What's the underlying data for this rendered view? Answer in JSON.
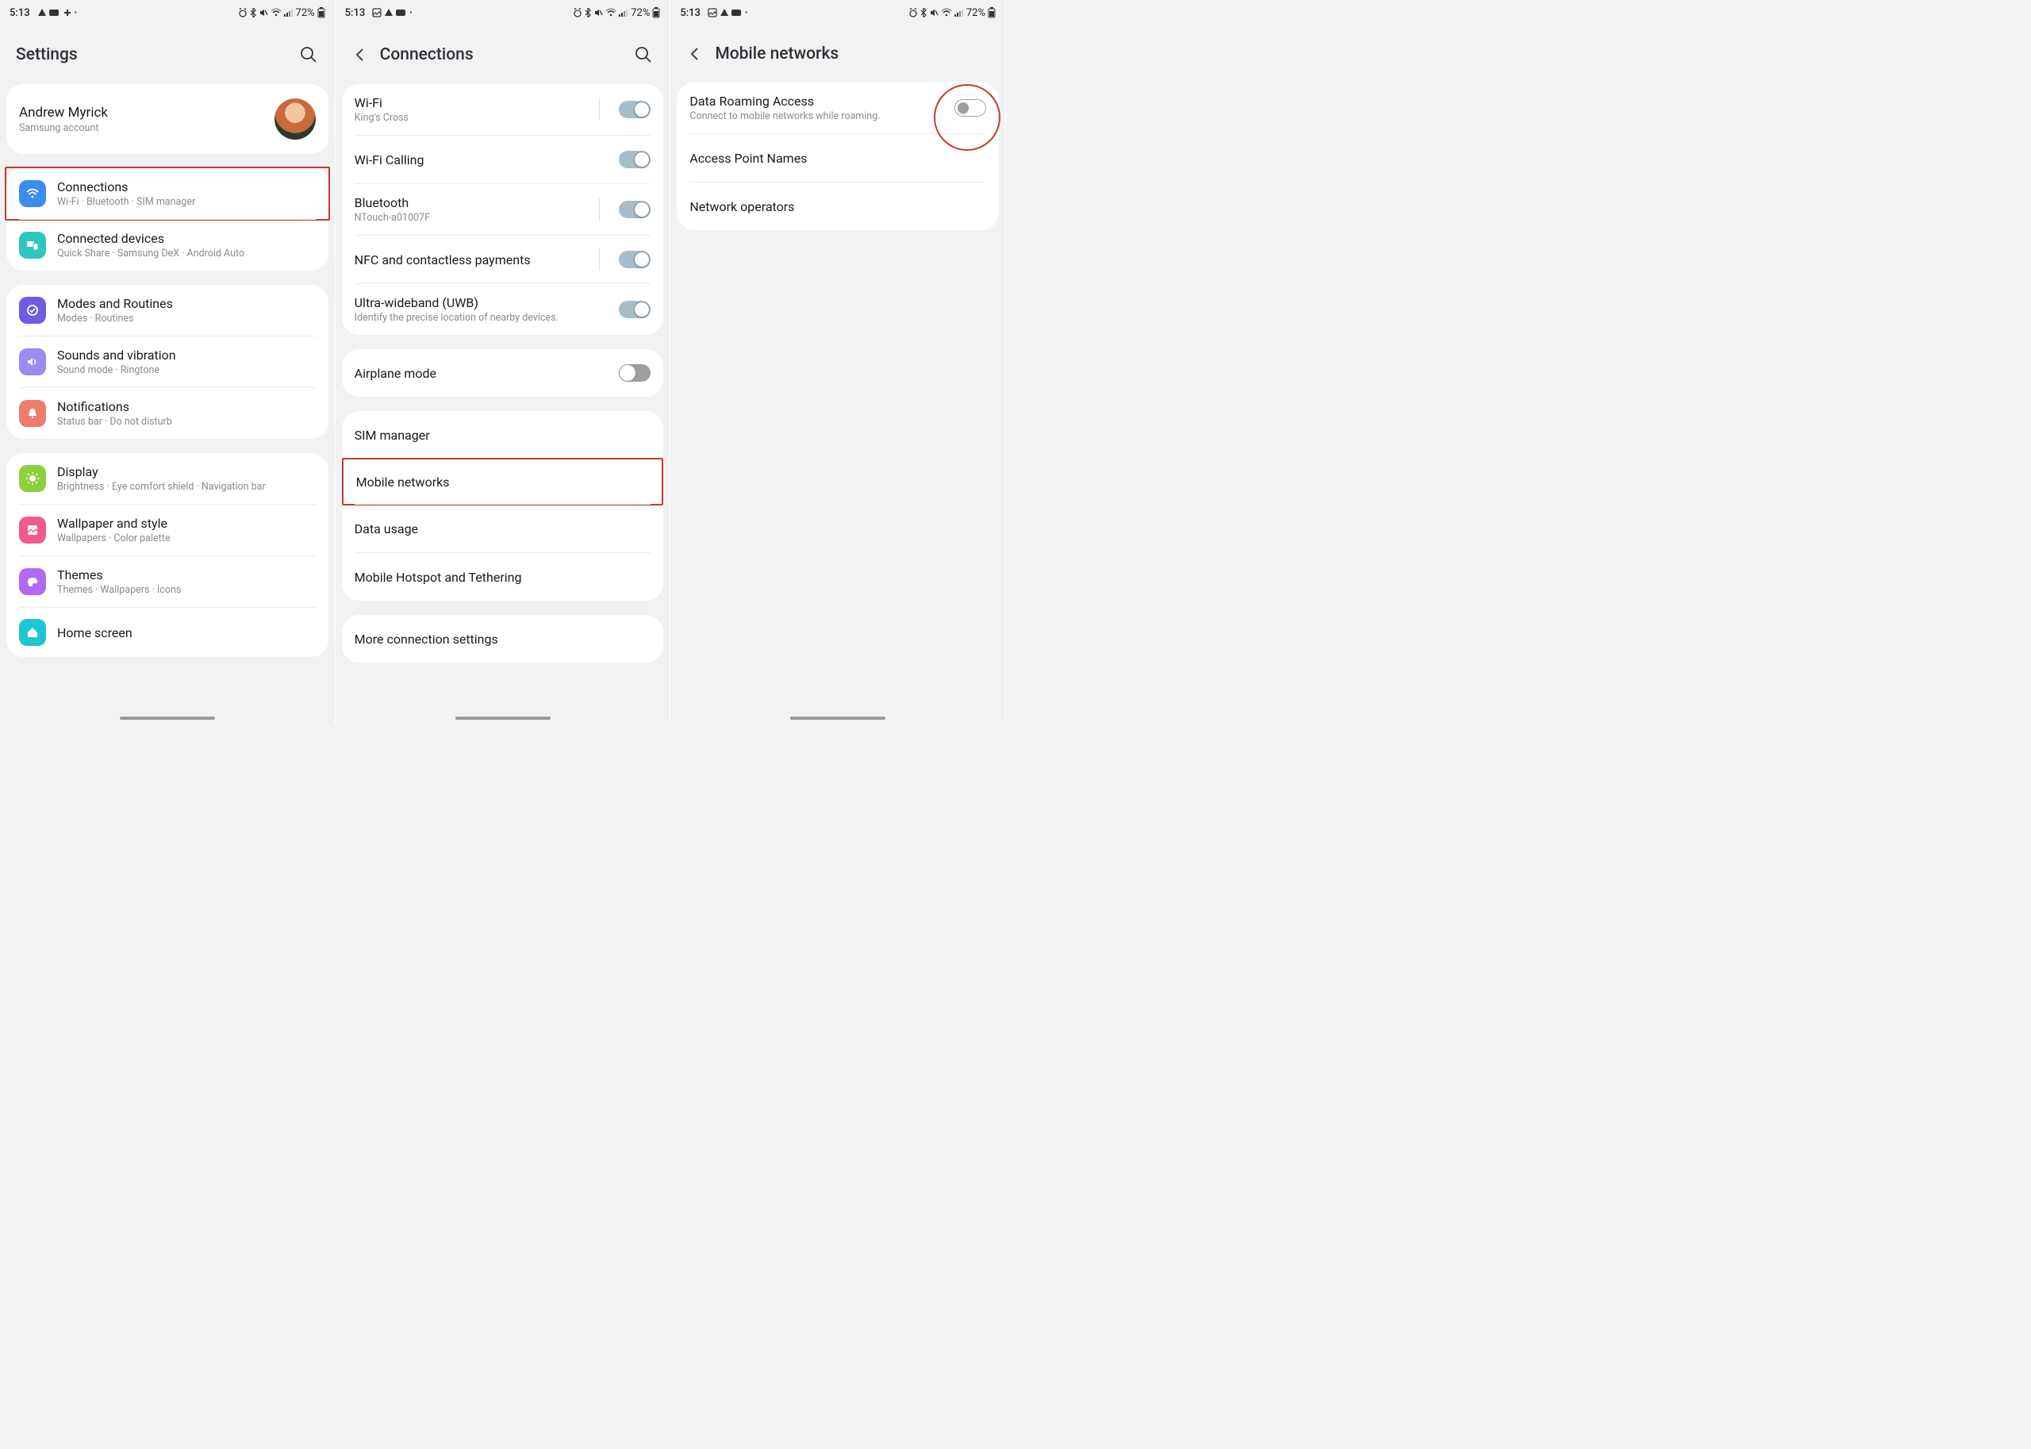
{
  "statusbar": {
    "time": "5:13",
    "battery_pct": "72%"
  },
  "screen1": {
    "header_title": "Settings",
    "profile_name": "Andrew Myrick",
    "profile_sub": "Samsung account",
    "items": [
      {
        "title": "Connections",
        "sub": "Wi-Fi · Bluetooth · SIM manager"
      },
      {
        "title": "Connected devices",
        "sub": "Quick Share · Samsung DeX · Android Auto"
      },
      {
        "title": "Modes and Routines",
        "sub": "Modes · Routines"
      },
      {
        "title": "Sounds and vibration",
        "sub": "Sound mode · Ringtone"
      },
      {
        "title": "Notifications",
        "sub": "Status bar · Do not disturb"
      },
      {
        "title": "Display",
        "sub": "Brightness · Eye comfort shield · Navigation bar"
      },
      {
        "title": "Wallpaper and style",
        "sub": "Wallpapers · Color palette"
      },
      {
        "title": "Themes",
        "sub": "Themes · Wallpapers · Icons"
      },
      {
        "title": "Home screen",
        "sub": ""
      }
    ]
  },
  "screen2": {
    "header_title": "Connections",
    "rows": [
      {
        "title": "Wi-Fi",
        "sub": "King's Cross",
        "toggle": "on"
      },
      {
        "title": "Wi-Fi Calling",
        "sub": "",
        "toggle": "on"
      },
      {
        "title": "Bluetooth",
        "sub": "NTouch-a01007F",
        "toggle": "on"
      },
      {
        "title": "NFC and contactless payments",
        "sub": "",
        "toggle": "on"
      },
      {
        "title": "Ultra-wideband (UWB)",
        "sub": "Identify the precise location of nearby devices.",
        "toggle": "on"
      }
    ],
    "airplane": {
      "title": "Airplane mode",
      "toggle": "off"
    },
    "list2": [
      {
        "title": "SIM manager"
      },
      {
        "title": "Mobile networks"
      },
      {
        "title": "Data usage"
      },
      {
        "title": "Mobile Hotspot and Tethering"
      }
    ],
    "more": {
      "title": "More connection settings"
    }
  },
  "screen3": {
    "header_title": "Mobile networks",
    "rows": [
      {
        "title": "Data Roaming Access",
        "sub": "Connect to mobile networks while roaming."
      },
      {
        "title": "Access Point Names"
      },
      {
        "title": "Network operators"
      }
    ]
  }
}
